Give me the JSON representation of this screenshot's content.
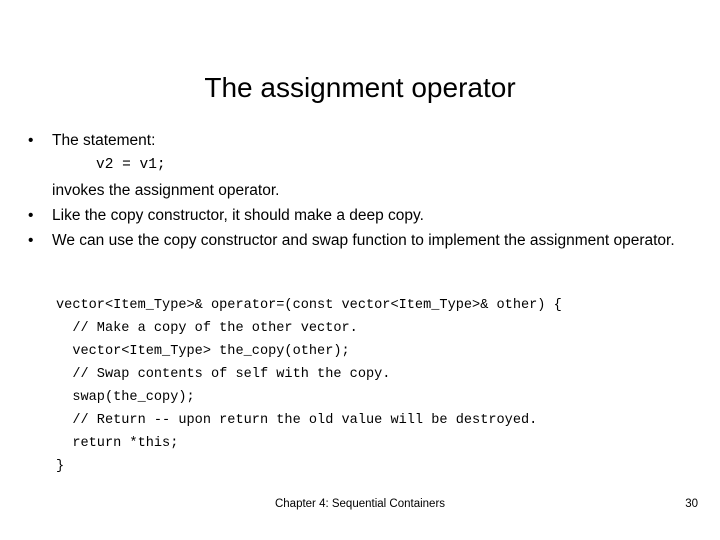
{
  "slide": {
    "title": "The assignment operator",
    "bullets": [
      {
        "marker": "•",
        "lines": [
          {
            "kind": "text",
            "text": "The statement:"
          },
          {
            "kind": "code",
            "text": "v2 = v1;"
          },
          {
            "kind": "text",
            "text": "invokes the assignment operator."
          }
        ]
      },
      {
        "marker": "•",
        "lines": [
          {
            "kind": "text",
            "text": "Like the copy constructor, it should make a deep copy."
          }
        ]
      },
      {
        "marker": "•",
        "lines": [
          {
            "kind": "text",
            "text": "We can use the copy constructor and swap function to implement the assignment operator."
          }
        ]
      }
    ],
    "code_block": [
      "vector<Item_Type>& operator=(const vector<Item_Type>& other) {",
      "  // Make a copy of the other vector.",
      "  vector<Item_Type> the_copy(other);",
      "  // Swap contents of self with the copy.",
      "  swap(the_copy);",
      "  // Return -- upon return the old value will be destroyed.",
      "  return *this;",
      "}"
    ]
  },
  "footer": {
    "title": "Chapter 4: Sequential Containers",
    "page_number": "30"
  },
  "colors": {
    "background": "#ffffff",
    "text": "#000000"
  }
}
